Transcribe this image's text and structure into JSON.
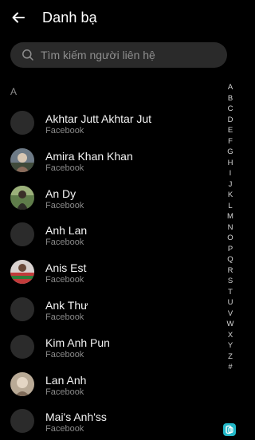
{
  "header": {
    "title": "Danh bạ",
    "back_icon": "arrow-left-icon"
  },
  "search": {
    "placeholder": "Tìm kiếm người liên hệ",
    "value": "",
    "icon": "search-icon"
  },
  "section": {
    "letter": "A"
  },
  "contacts": [
    {
      "name": "Akhtar Jutt Akhtar Jut",
      "source": "Facebook",
      "avatar": "blank"
    },
    {
      "name": "Amira Khan Khan",
      "source": "Facebook",
      "avatar": "photo"
    },
    {
      "name": "An Dy",
      "source": "Facebook",
      "avatar": "photo"
    },
    {
      "name": "Anh Lan",
      "source": "Facebook",
      "avatar": "blank"
    },
    {
      "name": "Anis Est",
      "source": "Facebook",
      "avatar": "photo"
    },
    {
      "name": "Ank Thư",
      "source": "Facebook",
      "avatar": "blank"
    },
    {
      "name": "Kim Anh Pun",
      "source": "Facebook",
      "avatar": "blank"
    },
    {
      "name": "Lan Anh",
      "source": "Facebook",
      "avatar": "photo"
    },
    {
      "name": "Mai's Anh'ss",
      "source": "Facebook",
      "avatar": "blank"
    }
  ],
  "alphabet": [
    "A",
    "B",
    "C",
    "D",
    "E",
    "F",
    "G",
    "H",
    "I",
    "J",
    "K",
    "L",
    "M",
    "N",
    "O",
    "P",
    "Q",
    "R",
    "S",
    "T",
    "U",
    "V",
    "W",
    "X",
    "Y",
    "Z",
    "#"
  ],
  "colors": {
    "background": "#000000",
    "search_bg": "#2a2a2a",
    "avatar_placeholder": "#2b2b2b",
    "secondary_text": "#8a8a8a"
  }
}
